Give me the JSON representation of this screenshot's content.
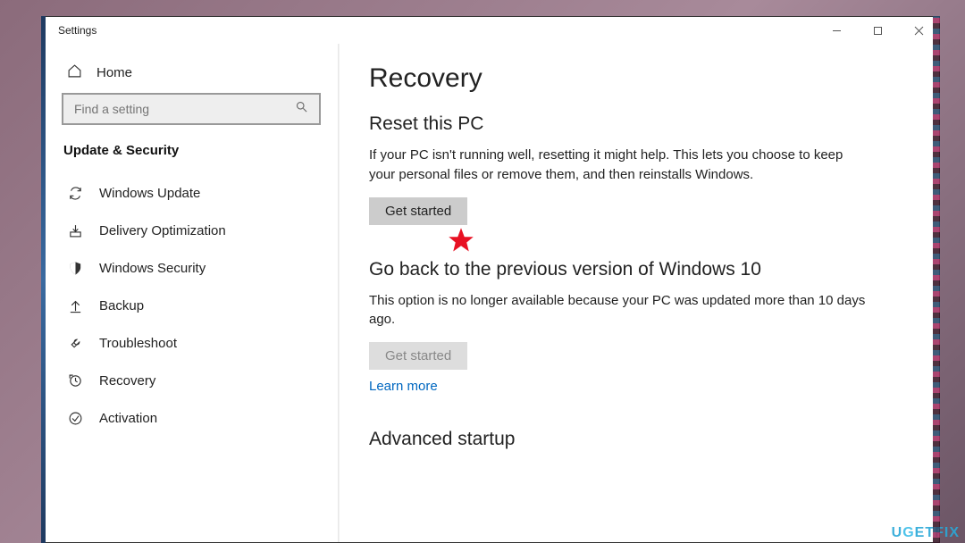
{
  "window": {
    "title": "Settings"
  },
  "sidebar": {
    "home": "Home",
    "search_placeholder": "Find a setting",
    "category": "Update & Security",
    "items": [
      {
        "label": "Windows Update",
        "icon": "sync-icon"
      },
      {
        "label": "Delivery Optimization",
        "icon": "download-icon"
      },
      {
        "label": "Windows Security",
        "icon": "shield-icon"
      },
      {
        "label": "Backup",
        "icon": "backup-arrow-icon"
      },
      {
        "label": "Troubleshoot",
        "icon": "wrench-icon"
      },
      {
        "label": "Recovery",
        "icon": "recovery-icon"
      },
      {
        "label": "Activation",
        "icon": "check-circle-icon"
      }
    ]
  },
  "page": {
    "title": "Recovery",
    "sections": {
      "reset": {
        "heading": "Reset this PC",
        "text": "If your PC isn't running well, resetting it might help. This lets you choose to keep your personal files or remove them, and then reinstalls Windows.",
        "button": "Get started"
      },
      "goback": {
        "heading": "Go back to the previous version of Windows 10",
        "text": "This option is no longer available because your PC was updated more than 10 days ago.",
        "button": "Get started",
        "link": "Learn more"
      },
      "advanced": {
        "heading": "Advanced startup"
      }
    }
  },
  "watermark": "UGETFIX"
}
